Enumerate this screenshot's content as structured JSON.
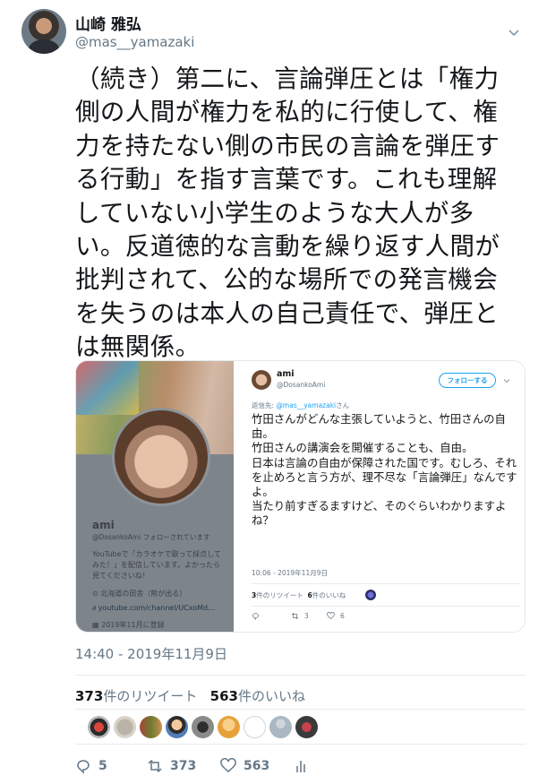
{
  "tweet": {
    "display_name": "山崎 雅弘",
    "handle": "@mas__yamazaki",
    "text": "（続き）第二に、言論弾圧とは「権力側の人間が権力を私的に行使して、権力を持たない側の市民の言論を弾圧する行動」を指す言葉です。これも理解していない小学生のような大人が多い。反道徳的な言動を繰り返す人間が批判されて、公的な場所での発言機会を失うのは本人の自己責任で、弾圧とは無関係。",
    "timestamp": "14:40 - 2019年11月9日",
    "retweets": "373",
    "retweets_label": "件のリツイート",
    "likes": "563",
    "likes_label": "件のいいね",
    "reply_count": "5",
    "retweet_count": "373",
    "like_count": "563"
  },
  "embedded": {
    "profile": {
      "name": "ami",
      "handle_line": "@DosankoAmi  フォローされています",
      "bio": "YouTubeで「カラオケで歌って採点してみた！」を配信しています。よかったら見てくださいね！",
      "location": "北海道の田舎（熊が出る）",
      "link": "youtube.com/channel/UCxoMd…",
      "joined": "2019年11月に登録"
    },
    "tweet": {
      "name": "ami",
      "handle": "@DosankoAmi",
      "follow_label": "フォローする",
      "reply_prefix": "返信先: ",
      "reply_mention": "@mas__yamazaki",
      "reply_suffix": "さん",
      "text": "竹田さんがどんな主張していようと、竹田さんの自由。\n竹田さんの講演会を開催することも、自由。\n日本は言論の自由が保障された国です。むしろ、それを止めろと言う方が、理不尽な「言論弾圧」なんですよ。\n当たり前すぎるますけど、そのぐらいわかりますよね？",
      "time": "10:06 - 2019年11月9日",
      "retweets": "3",
      "retweets_label": "件のリツイート",
      "likes": "6",
      "likes_label": "件のいいね",
      "rt_action": "3",
      "like_action": "6"
    }
  },
  "colors": {
    "accent": "#1da1f2",
    "muted": "#657786",
    "text": "#14171a"
  },
  "icons": [
    "chevron-down-icon",
    "reply-icon",
    "retweet-icon",
    "like-icon",
    "analytics-icon",
    "location-icon",
    "link-icon",
    "calendar-icon"
  ]
}
